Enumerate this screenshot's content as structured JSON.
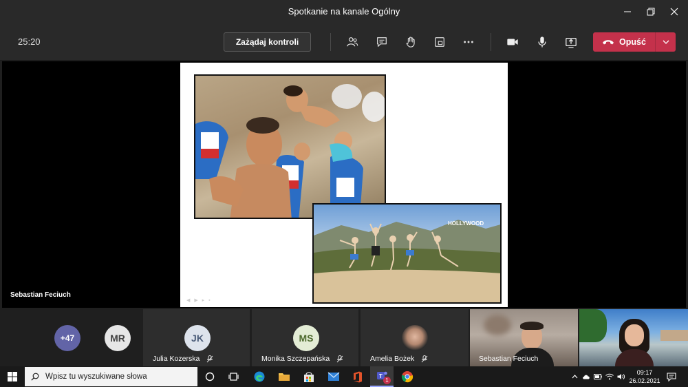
{
  "window": {
    "title": "Spotkanie na kanale Ogólny"
  },
  "toolbar": {
    "timer": "25:20",
    "request_control_label": "Zażądaj kontroli",
    "leave_label": "Opuść",
    "icons": [
      "people-icon",
      "chat-icon",
      "raise-hand-icon",
      "rooms-icon",
      "more-icon",
      "camera-icon",
      "microphone-icon",
      "share-icon"
    ]
  },
  "stage": {
    "presenter_name": "Sebastian Feciuch",
    "slide_controls": "◀ ▶ ▸ ▪"
  },
  "participants": {
    "overflow_count": "+47",
    "tiles": [
      {
        "initials": "MR",
        "name": "",
        "muted": false
      },
      {
        "initials": "JK",
        "name": "Julia Kozerska",
        "muted": true
      },
      {
        "initials": "MS",
        "name": "Monika Szczepańska",
        "muted": true
      },
      {
        "initials": "",
        "name": "Amelia Bożek",
        "muted": true
      },
      {
        "initials": "",
        "name": "Sebastian Feciuch",
        "muted": false
      },
      {
        "initials": "",
        "name": "",
        "muted": false
      }
    ]
  },
  "taskbar": {
    "search_placeholder": "Wpisz tu wyszukiwane słowa",
    "time": "09:17",
    "date": "26.02.2021",
    "teams_badge": "1"
  },
  "colors": {
    "leave_red": "#c4314b",
    "overflow_purple": "#6264a7",
    "window_bg": "#292929"
  }
}
